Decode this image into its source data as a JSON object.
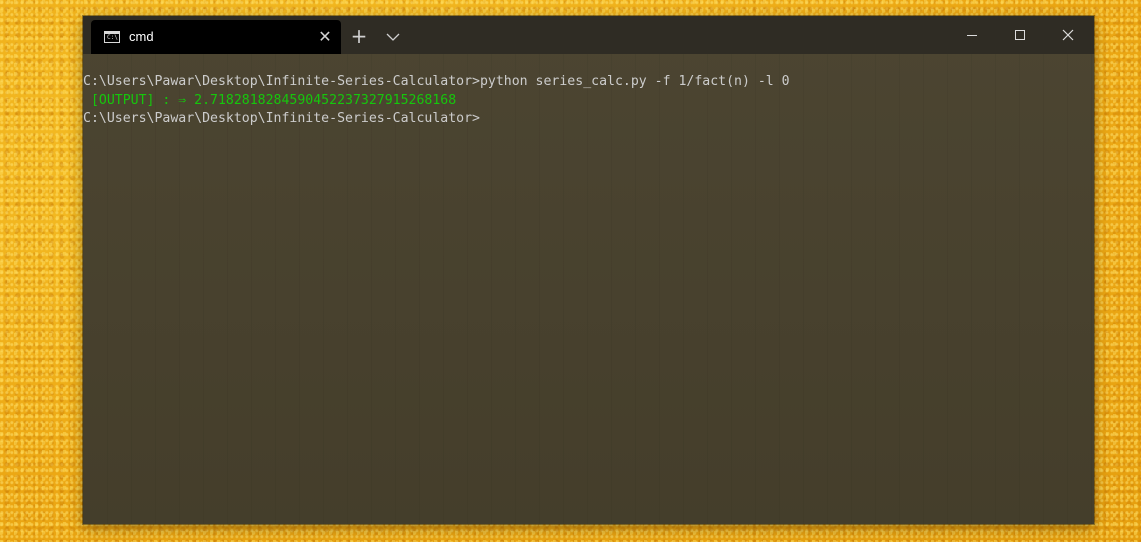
{
  "colors": {
    "wallpaper": "#f3b419",
    "titlebar": "#2f2c24",
    "active_tab": "#000000",
    "terminal_bg": "#48412d",
    "text": "#cccccc",
    "output_text": "#16c60c"
  },
  "titlebar": {
    "tab": {
      "icon": "cmd-icon",
      "icon_glyph": "C:\\",
      "title": "cmd",
      "close_glyph": "✕"
    },
    "new_tab_glyph": "+",
    "dropdown_icon": "chevron-down-icon",
    "controls": {
      "minimize_icon": "minimize-icon",
      "maximize_icon": "maximize-icon",
      "close_icon": "close-icon"
    }
  },
  "terminal": {
    "lines": [
      "C:\\Users\\Pawar\\Desktop\\Infinite-Series-Calculator>python series_calc.py -f 1/fact(n) -l 0",
      " [OUTPUT] : ⇒ 2.71828182845904522373279152681​68",
      "C:\\Users\\Pawar\\Desktop\\Infinite-Series-Calculator>"
    ]
  }
}
